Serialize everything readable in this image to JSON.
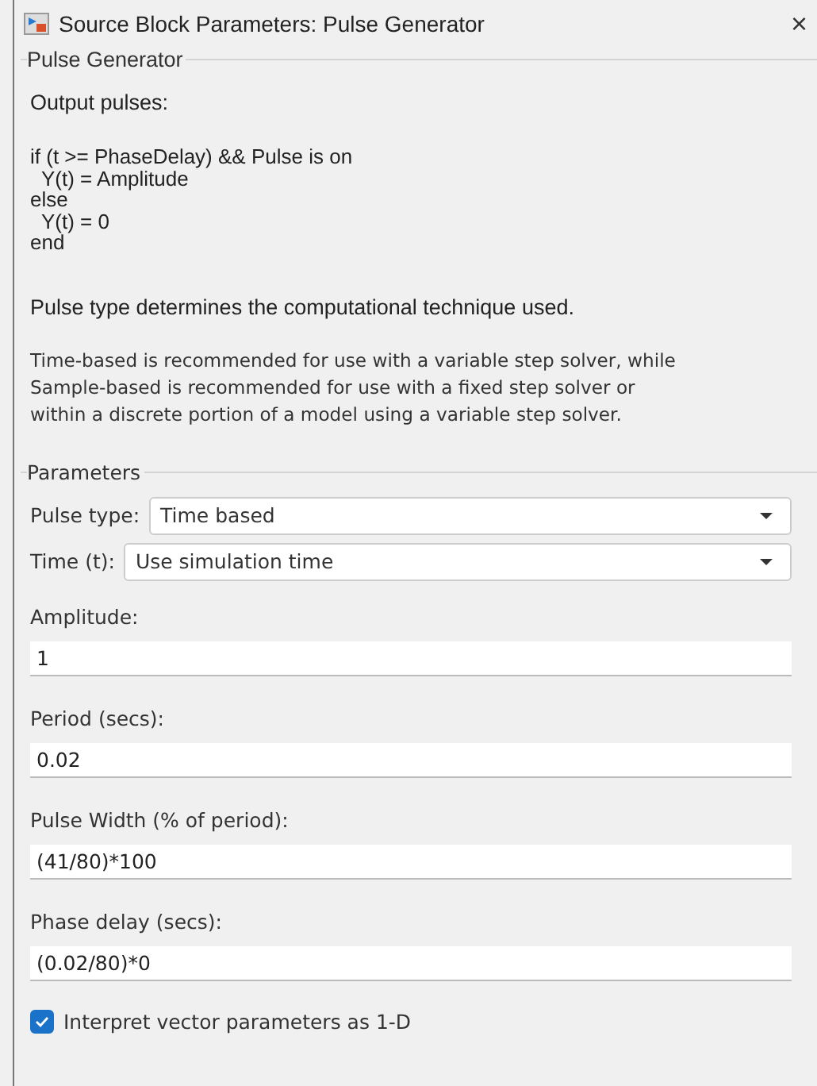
{
  "window": {
    "title": "Source Block Parameters: Pulse Generator",
    "close": "×"
  },
  "description": {
    "legend": "Pulse Generator",
    "heading": "Output pulses:",
    "code": [
      "if (t >= PhaseDelay) && Pulse is on",
      "  Y(t) = Amplitude",
      "else",
      "  Y(t) = 0",
      "end"
    ],
    "note": "Pulse type determines the computational technique used.",
    "detail": [
      "Time-based is recommended for use with a variable step solver, while",
      "Sample-based is recommended for use with a fixed step solver or",
      "within a discrete portion of a model using a variable step solver."
    ]
  },
  "parameters": {
    "legend": "Parameters",
    "items": [
      {
        "kind": "dropdown",
        "label": "Pulse type:",
        "value": "Time based"
      },
      {
        "kind": "dropdown",
        "label": "Time (t):",
        "value": "Use simulation time"
      },
      {
        "kind": "text",
        "label": "Amplitude:",
        "value": "1"
      },
      {
        "kind": "text",
        "label": "Period (secs):",
        "value": "0.02"
      },
      {
        "kind": "text",
        "label": "Pulse Width (% of period):",
        "value": "(41/80)*100"
      },
      {
        "kind": "text",
        "label": "Phase delay (secs):",
        "value": "(0.02/80)*0"
      },
      {
        "kind": "checkbox",
        "label": "Interpret vector parameters as 1-D",
        "checked": true
      }
    ]
  }
}
